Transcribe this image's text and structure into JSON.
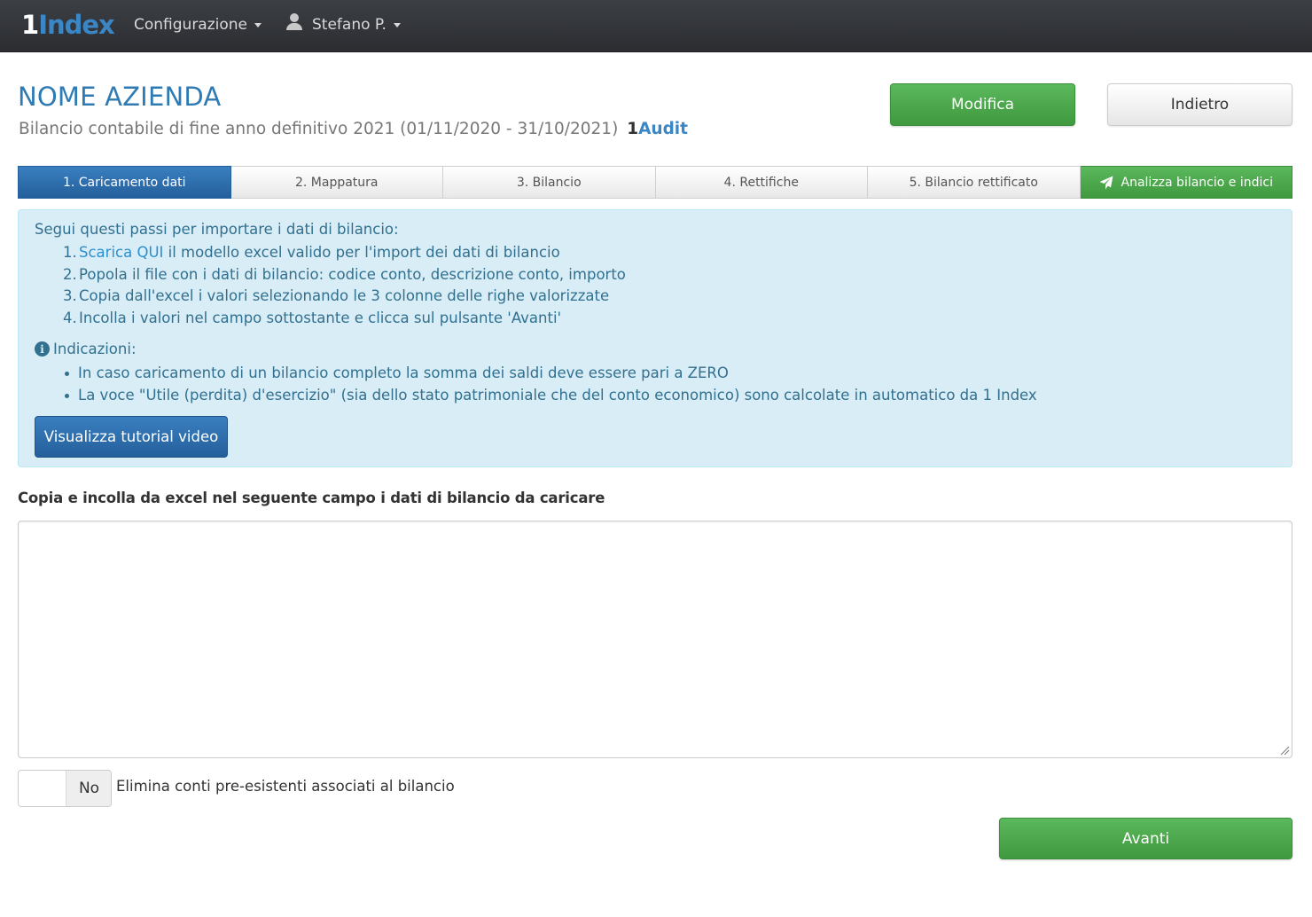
{
  "navbar": {
    "brand_one": "1",
    "brand_rest": "Index",
    "config_label": "Configurazione",
    "user_label": "Stefano P."
  },
  "header": {
    "company_name": "NOME AZIENDA",
    "subtitle": "Bilancio contabile di fine anno definitivo 2021 (01/11/2020 - 31/10/2021)",
    "audit_logo_one": "1",
    "audit_logo_rest": "Audit",
    "modify_label": "Modifica",
    "back_label": "Indietro"
  },
  "steps": [
    {
      "label": "1. Caricamento dati",
      "active": true
    },
    {
      "label": "2. Mappatura"
    },
    {
      "label": "3. Bilancio"
    },
    {
      "label": "4. Rettifiche"
    },
    {
      "label": "5. Bilancio rettificato"
    },
    {
      "label": "Analizza bilancio e indici",
      "icon": "send-icon"
    }
  ],
  "info": {
    "title": "Segui questi passi per importare i dati di bilancio:",
    "steps": [
      {
        "num": "1.",
        "link": "Scarica QUI",
        "text": " il modello excel valido per l'import dei dati di bilancio"
      },
      {
        "num": "2.",
        "text": "Popola il file con i dati di bilancio: codice conto, descrizione conto, importo"
      },
      {
        "num": "3.",
        "text": "Copia dall'excel i valori selezionando le 3 colonne delle righe valorizzate"
      },
      {
        "num": "4.",
        "text": "Incolla i valori nel campo sottostante e clicca sul pulsante 'Avanti'"
      }
    ],
    "indications_title": "Indicazioni:",
    "indications": [
      "In caso caricamento di un bilancio completo la somma dei saldi deve essere pari a ZERO",
      "La voce \"Utile (perdita) d'esercizio\" (sia dello stato patrimoniale che del conto economico) sono calcolate in automatico da 1 Index"
    ],
    "video_button": "Visualizza tutorial video"
  },
  "paste": {
    "label": "Copia e incolla da excel nel seguente campo i dati di bilancio da caricare",
    "value": ""
  },
  "toggle": {
    "state": "No",
    "label": "Elimina conti pre-esistenti associati al bilancio"
  },
  "next_label": "Avanti",
  "colors": {
    "brand_blue": "#3b86c4",
    "primary": "#2e6da4",
    "success": "#4cae4c",
    "info_bg": "#d9edf7",
    "info_text": "#31708f"
  }
}
